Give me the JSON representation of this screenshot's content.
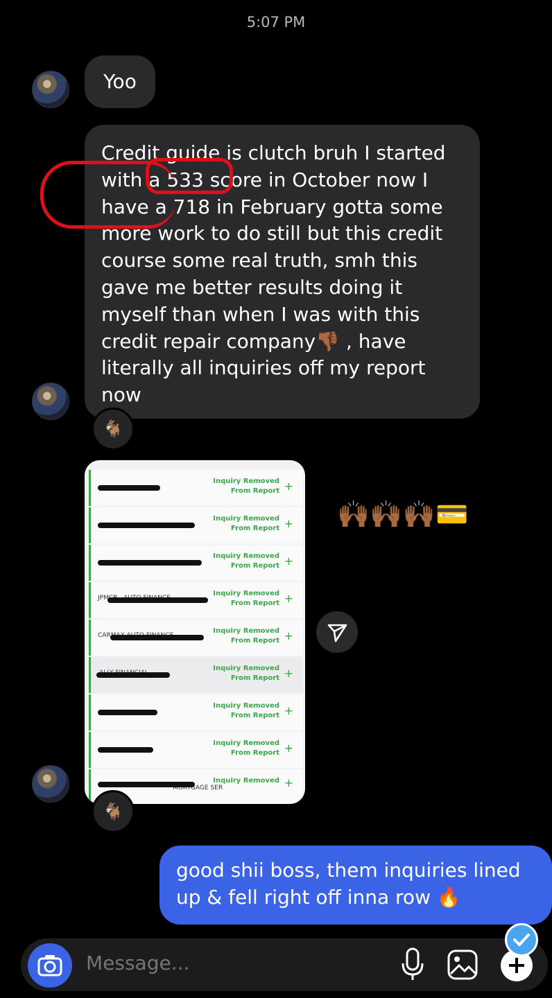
{
  "status": {
    "time": "5:07 PM"
  },
  "messages": {
    "first": "Yoo",
    "second": "Credit guide is clutch bruh I started with a 533 score in October now I have a 718 in February gotta some more work to do still but this credit course some real truth, smh this gave me better results doing it myself than when I was with this credit repair company👎🏾 , have literally all inquiries off my report now",
    "reaction": "🐐",
    "reaction2": "🐐",
    "emoji_sticker": "🙌🏾🙌🏾🙌🏾💳",
    "reply": "good shii boss, them inquiries lined up & fell right off inna row 🔥"
  },
  "card": {
    "rows": [
      {
        "status": "Inquiry Removed",
        "sub": "From Report"
      },
      {
        "status": "Inquiry Removed",
        "sub": "From Report"
      },
      {
        "status": "Inquiry Removed",
        "sub": "From Report"
      },
      {
        "status": "Inquiry Removed",
        "sub": "From Report",
        "name": "JPMCB - AUTO FINANCE"
      },
      {
        "status": "Inquiry Removed",
        "sub": "From Report",
        "name": "CARMAX AUTO FINANCE"
      },
      {
        "status": "Inquiry Removed",
        "sub": "From Report",
        "name": "ALLY FINANCIAL"
      },
      {
        "status": "Inquiry Removed",
        "sub": "From Report"
      },
      {
        "status": "Inquiry Removed",
        "sub": "From Report"
      },
      {
        "status": "Inquiry Removed",
        "sub": "",
        "name": "MORTGAGE SER"
      }
    ]
  },
  "composer": {
    "placeholder": "Message..."
  },
  "colors": {
    "accent": "#3b63e6",
    "bubble_in": "#2a2a2c",
    "green": "#3aa84a",
    "annotation": "#e0101a"
  },
  "icons": [
    "camera-icon",
    "microphone-icon",
    "gallery-icon",
    "plus-icon",
    "send-icon",
    "checkmark-icon"
  ]
}
